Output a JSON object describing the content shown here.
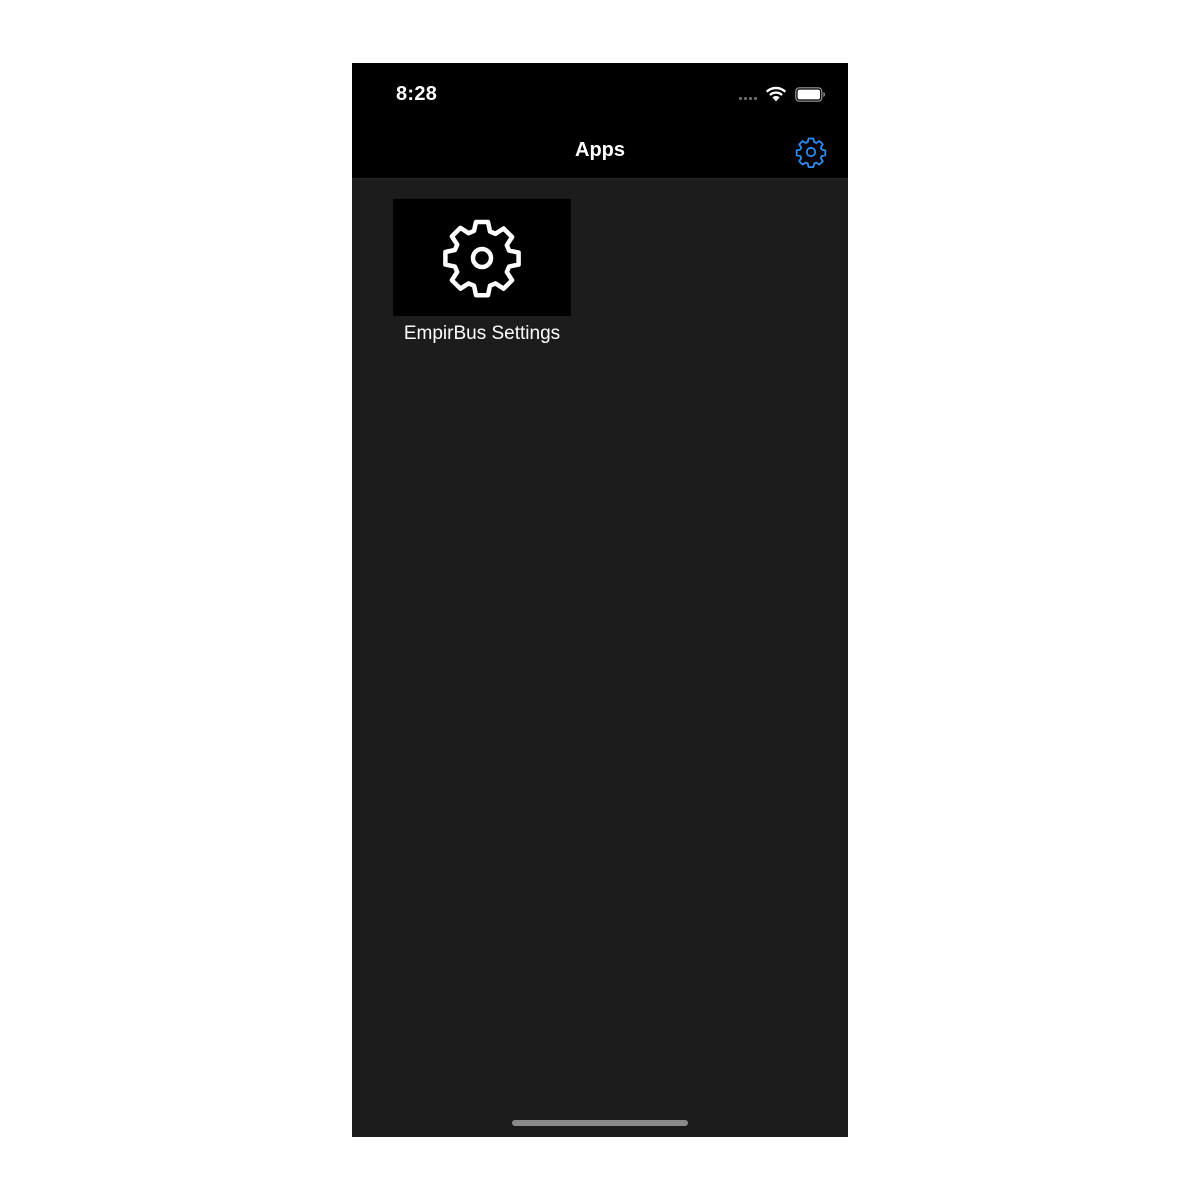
{
  "status_bar": {
    "time": "8:28",
    "signal_icon": "cellular-signal-icon",
    "wifi_icon": "wifi-icon",
    "battery_icon": "battery-icon"
  },
  "nav_bar": {
    "title": "Apps",
    "settings_icon": "gear-icon",
    "accent_color": "#2a8cf0"
  },
  "apps": [
    {
      "label": "EmpirBus Settings",
      "icon": "gear-icon"
    }
  ],
  "colors": {
    "background": "#1c1c1c",
    "bars": "#000000",
    "text": "#ffffff"
  }
}
